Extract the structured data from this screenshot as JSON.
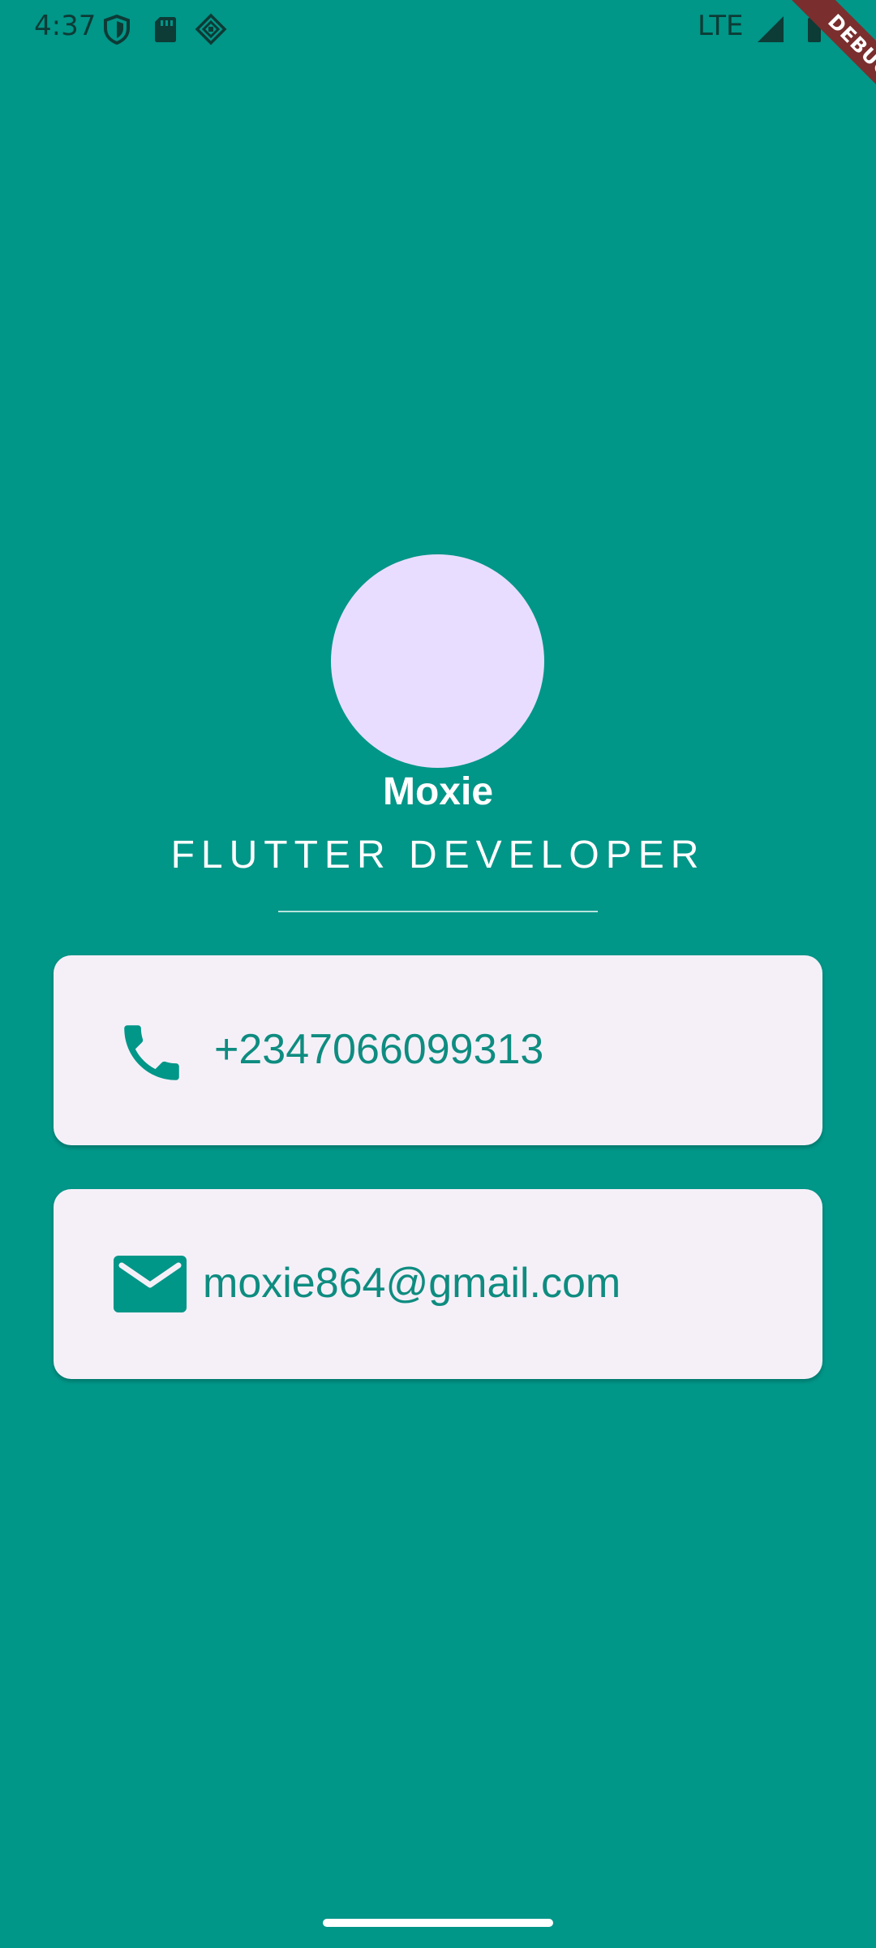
{
  "status_bar": {
    "time": "4:37",
    "network": "LTE",
    "icons": [
      "shield-icon",
      "sd-card-icon",
      "cast-icon",
      "signal-icon"
    ]
  },
  "debug_banner": "DEBUG",
  "profile": {
    "name": "Moxie",
    "title": "FLUTTER DEVELOPER"
  },
  "contacts": {
    "phone": {
      "icon": "phone-icon",
      "value": "+2347066099313"
    },
    "email": {
      "icon": "mail-icon",
      "value": "moxie864@gmail.com"
    }
  },
  "colors": {
    "background": "#009688",
    "card": "#f5f0f8",
    "avatar": "#e9ddff",
    "accent_text": "#0e8c80",
    "debug_banner": "#7a2e2e"
  }
}
